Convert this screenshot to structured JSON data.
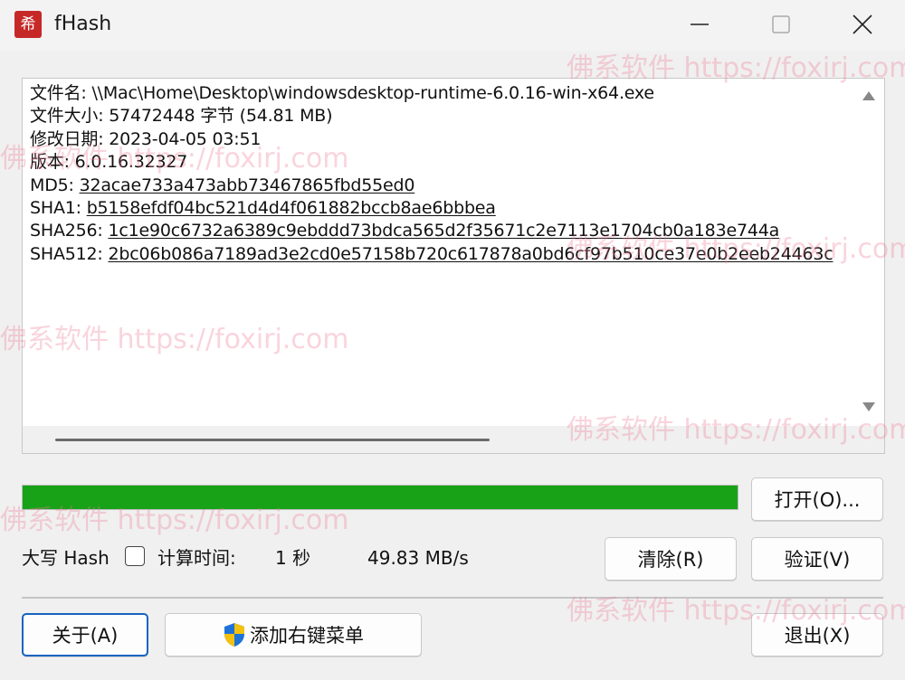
{
  "window": {
    "title": "fHash",
    "icon_glyph": "希"
  },
  "output": {
    "lines": [
      {
        "label": "文件名:",
        "value": "\\\\Mac\\Home\\Desktop\\windowsdesktop-runtime-6.0.16-win-x64.exe",
        "link": false
      },
      {
        "label": "文件大小:",
        "value": "57472448 字节 (54.81 MB)",
        "link": false
      },
      {
        "label": "修改日期:",
        "value": "2023-04-05 03:51",
        "link": false
      },
      {
        "label": "版本:",
        "value": "6.0.16.32327",
        "link": false
      },
      {
        "label": "MD5:",
        "value": "32acae733a473abb73467865fbd55ed0",
        "link": true
      },
      {
        "label": "SHA1:",
        "value": "b5158efdf04bc521d4d4f061882bccb8ae6bbbea",
        "link": true
      },
      {
        "label": "SHA256:",
        "value": "1c1e90c6732a6389c9ebddd73bdca565d2f35671c2e7113e1704cb0a183e744a",
        "link": true
      },
      {
        "label": "SHA512:",
        "value": "2bc06b086a7189ad3e2cd0e57158b720c617878a0bd6cf97b510ce37e0b2eeb24463c",
        "link": true
      }
    ]
  },
  "progress": {
    "percent": 100,
    "color": "#18a218"
  },
  "buttons": {
    "open": "打开(O)...",
    "clear": "清除(R)",
    "verify": "验证(V)",
    "about": "关于(A)",
    "context_menu": "添加右键菜单",
    "exit": "退出(X)"
  },
  "status": {
    "uppercase_label": "大写 Hash",
    "uppercase_checked": false,
    "time_label": "计算时间:",
    "time_value": "1 秒",
    "speed": "49.83 MB/s"
  },
  "watermark": {
    "text": "佛系软件 https://foxirj.com"
  },
  "icons": [
    "app-icon",
    "minimize-icon",
    "maximize-icon",
    "close-icon",
    "scroll-up-icon",
    "scroll-down-icon",
    "shield-icon"
  ]
}
